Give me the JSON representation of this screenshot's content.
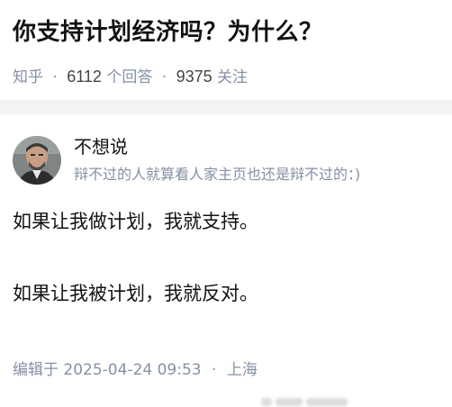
{
  "question": {
    "title": "你支持计划经济吗？为什么？",
    "source": "知乎",
    "answer_count": "6112",
    "answer_label": "个回答",
    "follower_count": "9375",
    "follower_label": "关注",
    "separator": "·"
  },
  "answer": {
    "author_name": "不想说",
    "author_bio": "辩不过的人就算看人家主页也还是辩不过的：)",
    "paragraphs": [
      "如果让我做计划，我就支持。",
      "如果让我被计划，我就反对。"
    ],
    "edit_prefix": "编辑于",
    "edit_time": "2025-04-24 09:53",
    "location": "上海"
  },
  "colors": {
    "title": "#121212",
    "meta": "#8590a6",
    "divider": "#f3f3f3"
  },
  "icons": [
    "avatar-image",
    "watermark-blur"
  ]
}
